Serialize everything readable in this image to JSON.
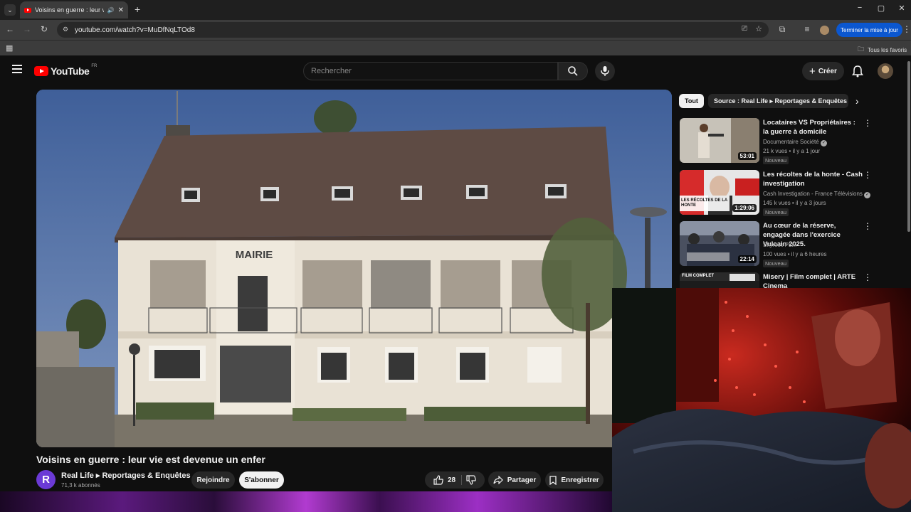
{
  "browser": {
    "tab_title": "Voisins en guerre : leur vie",
    "url": "youtube.com/watch?v=MuDfNqLTOd8",
    "update_button": "Terminer la mise à jour",
    "bookmarks_all": "Tous les favoris"
  },
  "header": {
    "logo_text": "YouTube",
    "country_code": "FR",
    "search_placeholder": "Rechercher",
    "create_label": "Créer"
  },
  "player": {
    "building_sign": "MAIRIE"
  },
  "video": {
    "title": "Voisins en guerre : leur vie est devenue un enfer",
    "channel_initial": "R",
    "channel_name": "Real Life ▸ Reportages & Enquêtes",
    "subscribers": "71,3 k abonnés",
    "join_label": "Rejoindre",
    "subscribe_label": "S'abonner",
    "likes": "28",
    "share_label": "Partager",
    "save_label": "Enregistrer"
  },
  "chips": {
    "all": "Tout",
    "source": "Source : Real Life ▸ Reportages & Enquêtes"
  },
  "recommendations": [
    {
      "title": "Locataires VS Propriétaires : la guerre à domicile",
      "channel": "Documentaire Société",
      "verified": true,
      "meta": "21 k vues • il y a 1 jour",
      "badge": "Nouveau",
      "duration": "53:01"
    },
    {
      "title": "Les récoltes de la honte - Cash investigation",
      "channel": "Cash Investigation - France Télévisions",
      "verified": true,
      "meta": "145 k vues • il y a 3 jours",
      "badge": "Nouveau",
      "duration": "1:29:06",
      "thumb_caption": "LES RÉCOLTES DE LA HONTE"
    },
    {
      "title": "Au cœur de la réserve, engagée dans l'exercice Vulcain 2025.",
      "channel": "Skyrock PLM",
      "verified": false,
      "meta": "100 vues • il y a 6 heures",
      "badge": "Nouveau",
      "duration": "22:14"
    },
    {
      "title": "Misery | Film complet | ARTE Cinema",
      "thumb_caption": "FILM COMPLET"
    }
  ],
  "colors": {
    "background": "#0f0f0f",
    "youtube_red": "#ff0000",
    "update_blue": "#0b57d0"
  }
}
